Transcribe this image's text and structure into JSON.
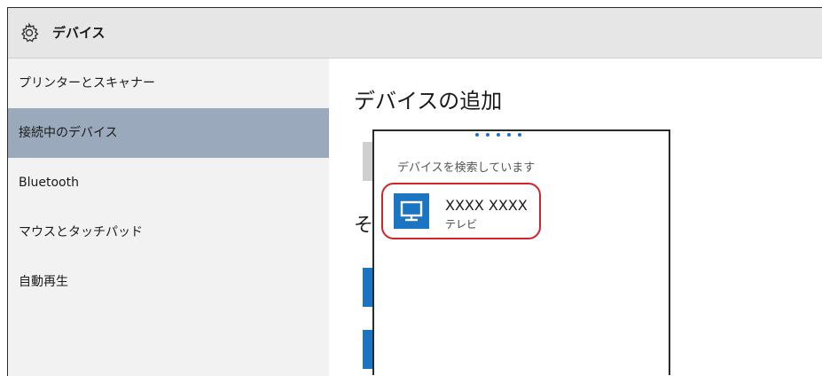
{
  "window": {
    "title": "デバイス",
    "icon": "gear-icon"
  },
  "sidebar": {
    "items": [
      {
        "label": "プリンターとスキャナー",
        "selected": false
      },
      {
        "label": "接続中のデバイス",
        "selected": true
      },
      {
        "label": "Bluetooth",
        "selected": false
      },
      {
        "label": "マウスとタッチパッド",
        "selected": false
      },
      {
        "label": "自動再生",
        "selected": false
      }
    ]
  },
  "main": {
    "heading": "デバイスの追加",
    "partial_text": "そ"
  },
  "popup": {
    "status": "デバイスを検索しています",
    "device": {
      "name": "XXXX XXXX",
      "type": "テレビ",
      "icon": "monitor-icon"
    }
  },
  "colors": {
    "accent": "#1c75c3",
    "selected_nav": "#9aa9bc",
    "highlight": "#d4242b"
  }
}
